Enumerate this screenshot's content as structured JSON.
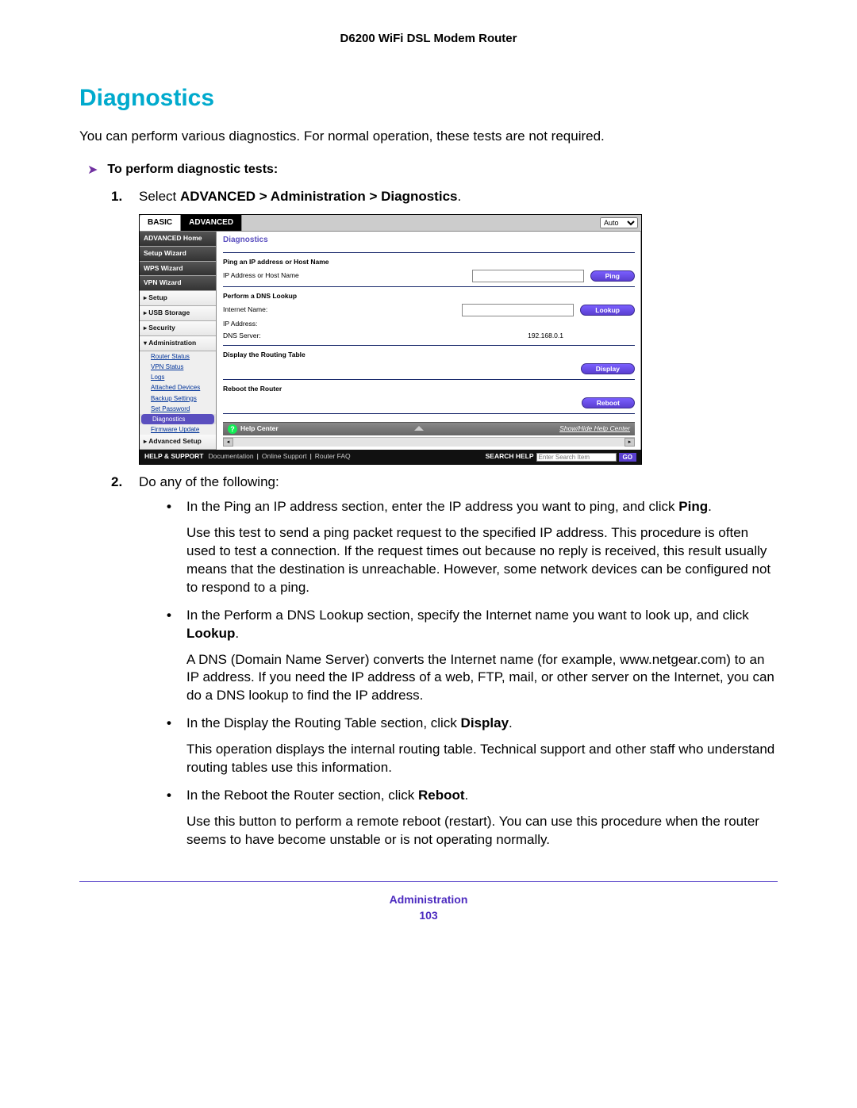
{
  "header": {
    "title": "D6200 WiFi DSL Modem Router"
  },
  "heading": "Diagnostics",
  "intro": "You can perform various diagnostics. For normal operation, these tests are not required.",
  "task_title": "To perform diagnostic tests:",
  "step1": {
    "prefix": "Select ",
    "path": "ADVANCED > Administration > Diagnostics",
    "suffix": "."
  },
  "screenshot": {
    "tabs": {
      "basic": "BASIC",
      "advanced": "ADVANCED",
      "auto": "Auto"
    },
    "sidebar": {
      "home": "ADVANCED Home",
      "setup_wizard": "Setup Wizard",
      "wps_wizard": "WPS Wizard",
      "vpn_wizard": "VPN Wizard",
      "setup": "Setup",
      "usb": "USB Storage",
      "security": "Security",
      "admin": "Administration",
      "subs": {
        "router_status": "Router Status",
        "vpn_status": "VPN Status",
        "logs": "Logs",
        "attached": "Attached Devices",
        "backup": "Backup Settings",
        "password": "Set Password",
        "diagnostics": "Diagnostics",
        "firmware": "Firmware Update"
      },
      "advanced_setup": "Advanced Setup"
    },
    "main": {
      "title": "Diagnostics",
      "ping_section": "Ping an IP address or Host Name",
      "ping_label": "IP Address or Host Name",
      "ping_btn": "Ping",
      "dns_section": "Perform a DNS Lookup",
      "internet_name": "Internet Name:",
      "ip_address": "IP Address:",
      "dns_server": "DNS Server:",
      "dns_value": "192.168.0.1",
      "lookup_btn": "Lookup",
      "routing_section": "Display the Routing Table",
      "display_btn": "Display",
      "reboot_section": "Reboot the Router",
      "reboot_btn": "Reboot"
    },
    "help": {
      "title": "Help Center",
      "toggle": "Show/Hide Help Center"
    },
    "footer": {
      "support": "HELP & SUPPORT",
      "doc": "Documentation",
      "online": "Online Support",
      "faq": "Router FAQ",
      "search_label": "SEARCH HELP",
      "search_placeholder": "Enter Search Item",
      "go": "GO"
    }
  },
  "step2": "Do any of the following:",
  "bullets": {
    "b1a": "In the Ping an IP address section, enter the IP address you want to ping, and click ",
    "b1b": "Ping",
    "b1c": ".",
    "b1p": "Use this test to send a ping packet request to the specified IP address. This procedure is often used to test a connection. If the request times out because no reply is received, this result usually means that the destination is unreachable. However, some network devices can be configured not to respond to a ping.",
    "b2a": "In the Perform a DNS Lookup section, specify the Internet name you want to look up, and click ",
    "b2b": "Lookup",
    "b2c": ".",
    "b2p": "A DNS (Domain Name Server) converts the Internet name (for example, www.netgear.com) to an IP address. If you need the IP address of a web, FTP, mail, or other server on the Internet, you can do a DNS lookup to find the IP address.",
    "b3a": "In the Display the Routing Table section, click ",
    "b3b": "Display",
    "b3c": ".",
    "b3p": "This operation displays the internal routing table. Technical support and other staff who understand routing tables use this information.",
    "b4a": "In the Reboot the Router section, click ",
    "b4b": "Reboot",
    "b4c": ".",
    "b4p": "Use this button to perform a remote reboot (restart). You can use this procedure when the router seems to have become unstable or is not operating normally."
  },
  "footer": {
    "section": "Administration",
    "page": "103"
  }
}
